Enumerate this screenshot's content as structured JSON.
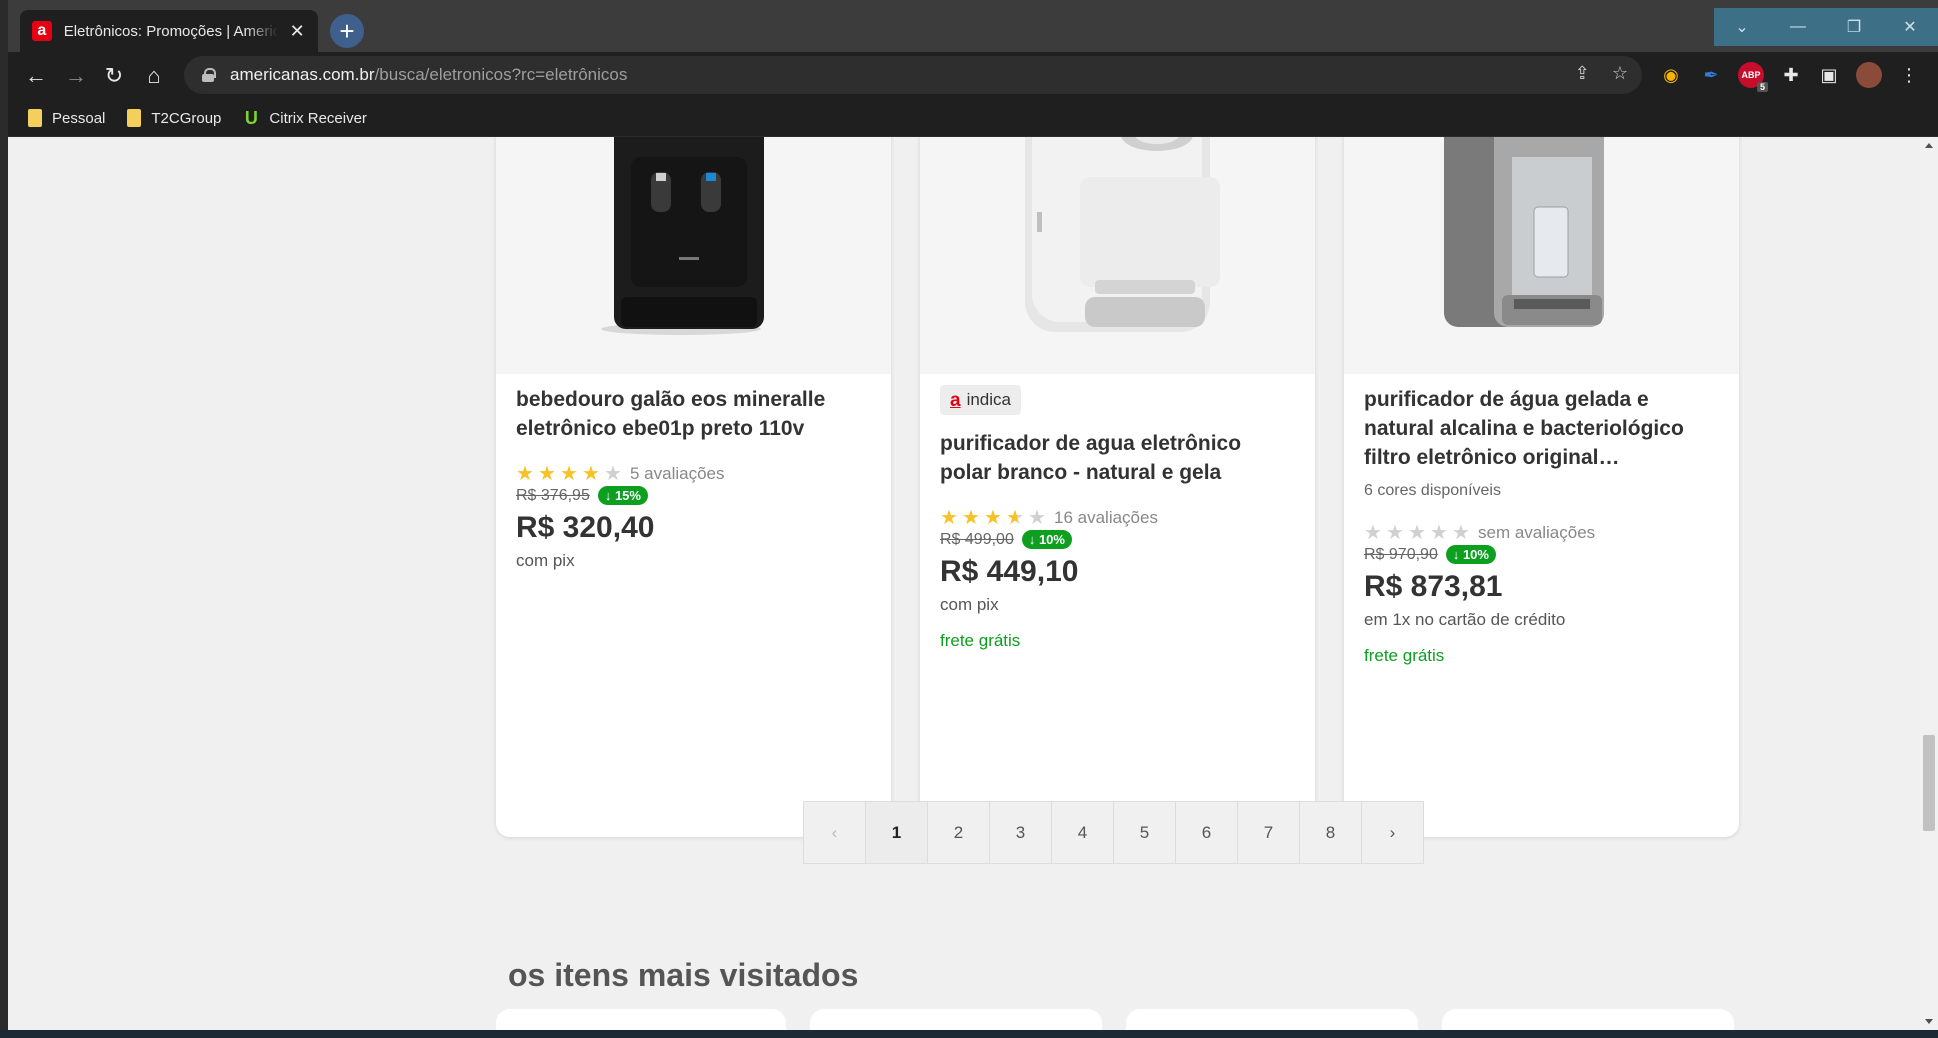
{
  "browser": {
    "tab_title": "Eletrônicos: Promoções | Americanas",
    "tab_favicon": "a",
    "url_host": "americanas.com.br",
    "url_path": "/busca/eletronicos?rc=eletrônicos",
    "abp_count": "5",
    "bookmarks": [
      {
        "label": "Pessoal",
        "icon": "folder-icon"
      },
      {
        "label": "T2CGroup",
        "icon": "folder-icon"
      },
      {
        "label": "Citrix Receiver",
        "icon": "citrix-icon"
      }
    ]
  },
  "products": [
    {
      "title": "bebedouro galão eos mineralle eletrônico ebe01p preto 110v",
      "rating_stars": 4,
      "rating_half": false,
      "reviews": "5 avaliações",
      "old_price": "R$ 376,95",
      "discount": "↓ 15%",
      "price": "R$ 320,40",
      "payment": "com pix"
    },
    {
      "badge": "indica",
      "badge_mark": "a",
      "title": "purificador de agua eletrônico polar branco - natural e gela",
      "rating_stars": 3,
      "rating_half": true,
      "reviews": "16 avaliações",
      "old_price": "R$ 499,00",
      "discount": "↓ 10%",
      "price": "R$ 449,10",
      "payment": "com pix",
      "shipping": "frete grátis"
    },
    {
      "title": "purificador de água gelada e natural alcalina e bacteriológico filtro eletrônico original…",
      "colors": "6 cores disponíveis",
      "rating_stars": 0,
      "rating_half": false,
      "reviews": "sem avaliações",
      "old_price": "R$ 970,90",
      "discount": "↓ 10%",
      "price": "R$ 873,81",
      "payment": "em 1x no cartão de crédito",
      "shipping": "frete grátis"
    }
  ],
  "pagination": {
    "prev": "‹",
    "next": "›",
    "pages": [
      "1",
      "2",
      "3",
      "4",
      "5",
      "6",
      "7",
      "8"
    ],
    "current": "1"
  },
  "section": {
    "title": "os itens mais visitados"
  }
}
